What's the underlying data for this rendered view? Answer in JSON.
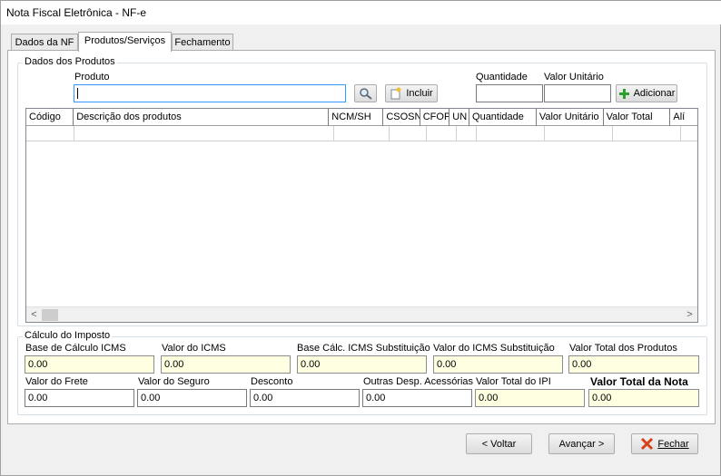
{
  "window": {
    "title": "Nota Fiscal Eletrônica - NF-e"
  },
  "tabs": [
    {
      "label": "Dados da NF"
    },
    {
      "label": "Produtos/Serviços"
    },
    {
      "label": "Fechamento"
    }
  ],
  "products": {
    "group_title": "Dados dos Produtos",
    "produto_label": "Produto",
    "produto_value": "",
    "incluir_label": "Incluir",
    "quantidade_label": "Quantidade",
    "quantidade_value": "",
    "valor_unitario_label": "Valor Unitário",
    "valor_unitario_value": "",
    "adicionar_label": "Adicionar"
  },
  "grid": {
    "columns": [
      "Código",
      "Descrição dos produtos",
      "NCM/SH",
      "CSOSN",
      "CFOP",
      "UN",
      "Quantidade",
      "Valor Unitário",
      "Valor Total",
      "Alí"
    ]
  },
  "taxes": {
    "group_title": "Cálculo do Imposto",
    "base_icms_label": "Base de Cálculo ICMS",
    "base_icms_value": "0.00",
    "valor_icms_label": "Valor do ICMS",
    "valor_icms_value": "0.00",
    "base_st_label": "Base Cálc. ICMS Substituição",
    "base_st_value": "0.00",
    "valor_st_label": "Valor do ICMS Substituição",
    "valor_st_value": "0.00",
    "total_produtos_label": "Valor Total dos Produtos",
    "total_produtos_value": "0.00",
    "frete_label": "Valor do Frete",
    "frete_value": "0.00",
    "seguro_label": "Valor do Seguro",
    "seguro_value": "0.00",
    "desconto_label": "Desconto",
    "desconto_value": "0.00",
    "outras_label": "Outras Desp. Acessórias",
    "outras_value": "0.00",
    "ipi_label": "Valor Total do IPI",
    "ipi_value": "0.00",
    "total_nota_label": "Valor Total da Nota",
    "total_nota_value": "0.00"
  },
  "footer": {
    "voltar_label": "< Voltar",
    "avancar_label": "Avançar >",
    "fechar_label": "Fechar"
  },
  "colors": {
    "readonly_field": "#ffffe1",
    "focus_border": "#3399ff",
    "add_icon": "#2e9e2e",
    "close_icon": "#d9401a"
  }
}
